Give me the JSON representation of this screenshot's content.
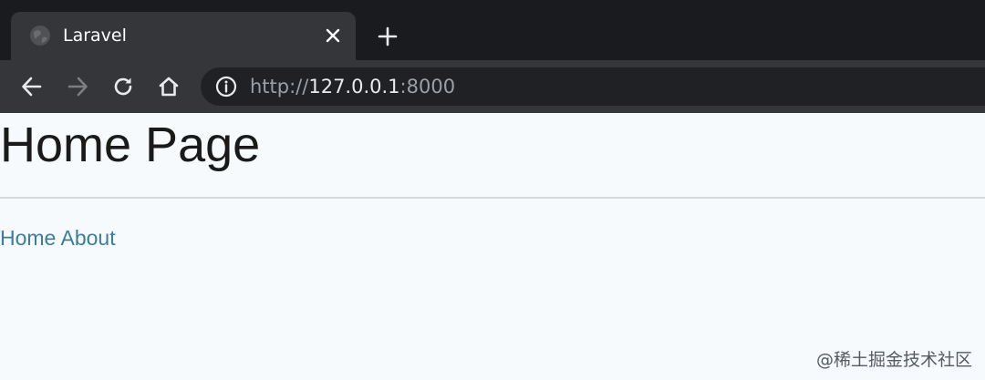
{
  "browser": {
    "tab": {
      "title": "Laravel",
      "favicon": "globe-icon",
      "close_icon": "close-icon"
    },
    "new_tab_icon": "plus-icon",
    "toolbar": {
      "back_icon": "arrow-left-icon",
      "forward_icon": "arrow-right-icon",
      "reload_icon": "reload-icon",
      "home_icon": "home-icon",
      "site_info_icon": "info-icon"
    },
    "address": {
      "scheme": "http://",
      "host": "127.0.0.1",
      "port": ":8000"
    }
  },
  "page": {
    "title": "Home Page",
    "nav": [
      {
        "label": "Home"
      },
      {
        "label": "About"
      }
    ]
  },
  "watermark": "@稀土掘金技术社区",
  "colors": {
    "link": "#3b7d9a",
    "page_background": "#f7fafc",
    "chrome_background": "#35363a"
  }
}
